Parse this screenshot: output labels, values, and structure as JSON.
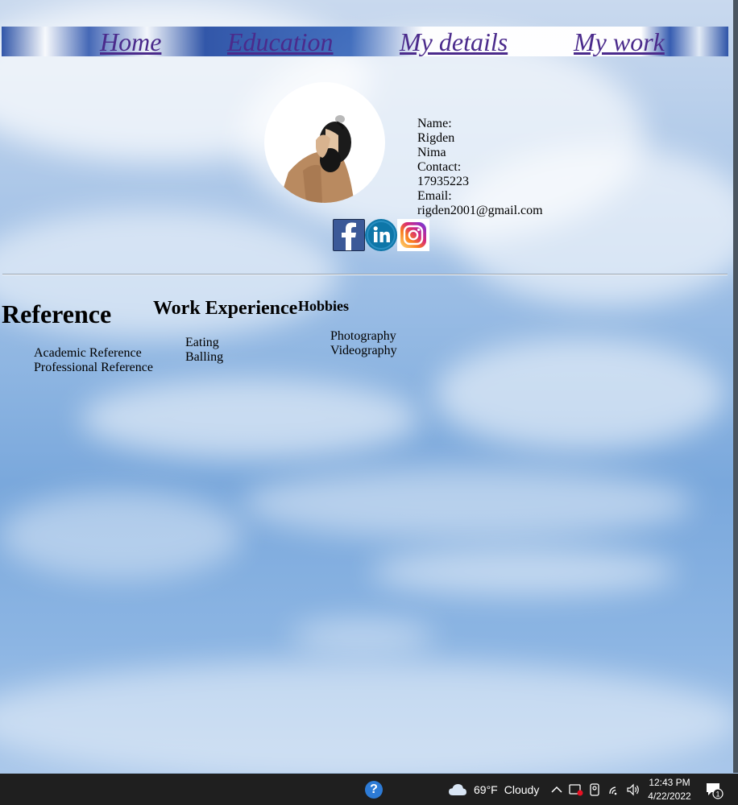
{
  "nav": {
    "items": [
      {
        "label": "Home"
      },
      {
        "label": "Education"
      },
      {
        "label": "My details"
      },
      {
        "label": "My work"
      }
    ]
  },
  "profile": {
    "lines": [
      "Name:",
      "Rigden",
      "Nima",
      "Contact:",
      "17935223",
      "Email:",
      "rigden2001@gmail.com"
    ]
  },
  "social": [
    "facebook-icon",
    "linkedin-icon",
    "instagram-icon"
  ],
  "sections": {
    "reference": {
      "title": "Reference",
      "items": [
        "Academic Reference",
        "Professional Reference"
      ]
    },
    "work": {
      "title": "Work Experience",
      "items": [
        "Eating",
        "Balling"
      ]
    },
    "hobbies": {
      "title": "Hobbies",
      "items": [
        "Photography",
        "Videography"
      ]
    }
  },
  "taskbar": {
    "temperature": "69°F",
    "condition": "Cloudy",
    "time": "12:43 PM",
    "date": "4/22/2022",
    "notification_count": "1"
  },
  "colors": {
    "link": "#4b2b8c",
    "taskbar": "#1f1f1f",
    "facebook": "#3b5998",
    "linkedin": "#0e76a8"
  }
}
